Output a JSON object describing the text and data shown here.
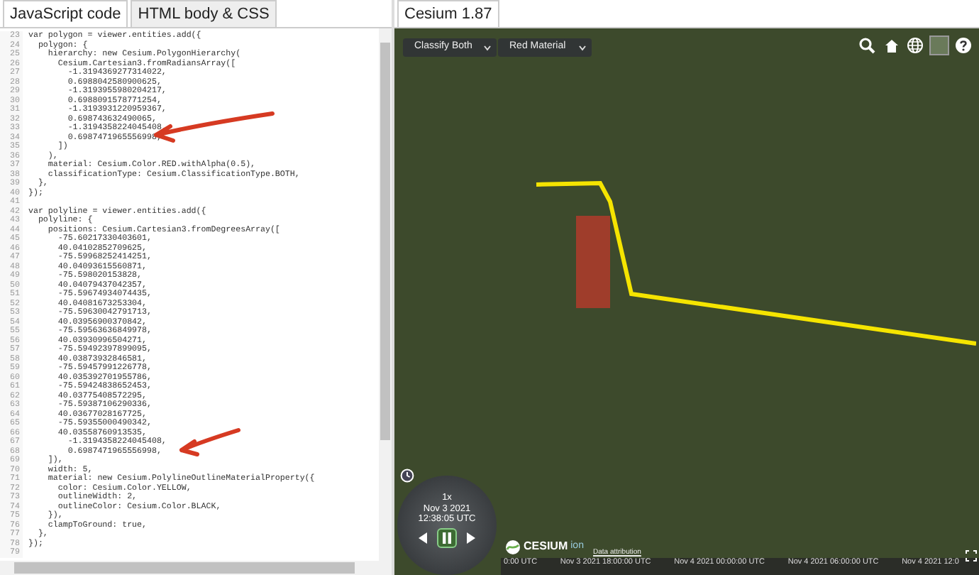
{
  "editor": {
    "tabs": [
      {
        "label": "JavaScript code",
        "selected": true
      },
      {
        "label": "HTML body & CSS",
        "selected": false
      }
    ],
    "lines": [
      {
        "number": "23",
        "text": "var polygon = viewer.entities.add({"
      },
      {
        "number": "24",
        "text": "  polygon: {"
      },
      {
        "number": "25",
        "text": "    hierarchy: new Cesium.PolygonHierarchy("
      },
      {
        "number": "26",
        "text": "      Cesium.Cartesian3.fromRadiansArray(["
      },
      {
        "number": "27",
        "text": "        -1.3194369277314022,"
      },
      {
        "number": "28",
        "text": "        0.6988042580900625,"
      },
      {
        "number": "29",
        "text": "        -1.3193955980204217,"
      },
      {
        "number": "30",
        "text": "        0.6988091578771254,"
      },
      {
        "number": "31",
        "text": "        -1.3193931220959367,"
      },
      {
        "number": "32",
        "text": "        0.698743632490065,"
      },
      {
        "number": "33",
        "text": "        -1.3194358224045408,"
      },
      {
        "number": "34",
        "text": "        0.6987471965556998,"
      },
      {
        "number": "35",
        "text": "      ])"
      },
      {
        "number": "36",
        "text": "    ),"
      },
      {
        "number": "37",
        "text": "    material: Cesium.Color.RED.withAlpha(0.5),"
      },
      {
        "number": "38",
        "text": "    classificationType: Cesium.ClassificationType.BOTH,"
      },
      {
        "number": "39",
        "text": "  },"
      },
      {
        "number": "40",
        "text": "});"
      },
      {
        "number": "41"
      },
      {
        "number": "42",
        "text": "var polyline = viewer.entities.add({"
      },
      {
        "number": "43",
        "text": "  polyline: {"
      },
      {
        "number": "44",
        "text": "    positions: Cesium.Cartesian3.fromDegreesArray(["
      },
      {
        "number": "45",
        "text": "      -75.60217330403601,"
      },
      {
        "number": "46",
        "text": "      40.04102852709625,"
      },
      {
        "number": "47",
        "text": "      -75.59968252414251,"
      },
      {
        "number": "48",
        "text": "      40.04093615560871,"
      },
      {
        "number": "49",
        "text": "      -75.598020153828,"
      },
      {
        "number": "50",
        "text": "      40.04079437042357,"
      },
      {
        "number": "51",
        "text": "      -75.59674934074435,"
      },
      {
        "number": "52",
        "text": "      40.04081673253304,"
      },
      {
        "number": "53",
        "text": "      -75.59630042791713,"
      },
      {
        "number": "54",
        "text": "      40.03956900370842,"
      },
      {
        "number": "55",
        "text": "      -75.59563636849978,"
      },
      {
        "number": "56",
        "text": "      40.03930996504271,"
      },
      {
        "number": "57",
        "text": "      -75.59492397899095,"
      },
      {
        "number": "58",
        "text": "      40.03873932846581,"
      },
      {
        "number": "59",
        "text": "      -75.59457991226778,"
      },
      {
        "number": "60",
        "text": "      40.035392701955786,"
      },
      {
        "number": "61",
        "text": "      -75.59424838652453,"
      },
      {
        "number": "62",
        "text": "      40.03775408572295,"
      },
      {
        "number": "63",
        "text": "      -75.59387106290336,"
      },
      {
        "number": "64",
        "text": "      40.03677028167725,"
      },
      {
        "number": "65",
        "text": "      -75.59355000490342,"
      },
      {
        "number": "66",
        "text": "      40.03558760913535,"
      },
      {
        "number": "67",
        "text": "        -1.3194358224045408,"
      },
      {
        "number": "68",
        "text": "        0.6987471965556998,"
      },
      {
        "number": "69",
        "text": "    ]),"
      },
      {
        "number": "70",
        "text": "    width: 5,"
      },
      {
        "number": "71",
        "text": "    material: new Cesium.PolylineOutlineMaterialProperty({"
      },
      {
        "number": "72",
        "text": "      color: Cesium.Color.YELLOW,"
      },
      {
        "number": "73",
        "text": "      outlineWidth: 2,"
      },
      {
        "number": "74",
        "text": "      outlineColor: Cesium.Color.BLACK,"
      },
      {
        "number": "75",
        "text": "    }),"
      },
      {
        "number": "76",
        "text": "    clampToGround: true,"
      },
      {
        "number": "77",
        "text": "  },"
      },
      {
        "number": "78",
        "text": "});"
      },
      {
        "number": "79"
      }
    ]
  },
  "viewer": {
    "tab": {
      "label": "Cesium 1.87",
      "selected": true
    },
    "dropdowns": [
      {
        "value": "Classify Both"
      },
      {
        "value": "Red Material"
      }
    ],
    "clock": {
      "speed": "1x",
      "date": "Nov 3 2021",
      "time": "12:38:05 UTC"
    },
    "controls": [
      {
        "kind": "reverse",
        "selected": false
      },
      {
        "kind": "pause",
        "selected": true
      },
      {
        "kind": "play",
        "selected": false
      }
    ],
    "logo": {
      "name": "CESIUM",
      "suffix": "ion"
    },
    "attribution": "Data attribution",
    "timeline": [
      "0:00 UTC",
      "Nov 3 2021 18:00:00 UTC",
      "Nov 4 2021 00:00:00 UTC",
      "Nov 4 2021 06:00:00 UTC",
      "Nov 4 2021 12:0"
    ]
  }
}
